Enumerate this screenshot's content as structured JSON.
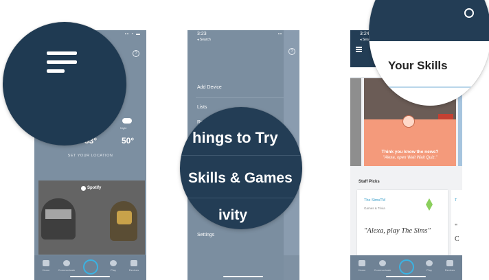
{
  "phone1": {
    "temps": [
      "53°",
      "50°"
    ],
    "night_label": "Night",
    "location_cta": "SET YOUR LOCATION",
    "spotify_label": "Spotify",
    "tabs": [
      "Home",
      "Communicate",
      "Play",
      "Devices"
    ]
  },
  "phone2": {
    "status_time": "3:23",
    "status_back": "◂ Search",
    "menu": [
      "Add Device",
      "Lists",
      "Reminders",
      "Settings"
    ],
    "zoom_lines": [
      "hings to Try",
      "Skills & Games",
      "ivity"
    ]
  },
  "phone3": {
    "status_time": "3:24",
    "status_back": "◂ Search",
    "zoom_title": "Your Skills",
    "news_title": "Think you know the news?",
    "news_sub": "\"Alexa, open Wait Wait Quiz.\"",
    "staff_picks_label": "Staff Picks",
    "skill_name": "The SimsTM",
    "skill_category": "Games & Trivia",
    "skill_quote": "\"Alexa, play The Sims\"",
    "peek_letter": "T",
    "peek_quote": "\"",
    "peek_char": "C",
    "tabs": [
      "Home",
      "Communicate",
      "Play",
      "Devices"
    ]
  },
  "colors": {
    "navy": "#1f3a52",
    "panel": "#7c8fa1",
    "alexa_ring": "#3ab3e3",
    "news_coral": "#f49a7b"
  },
  "icons": [
    "hamburger-icon",
    "help-icon",
    "cloud-icon",
    "spotify-icon",
    "alexa-icon",
    "home-icon",
    "chat-icon",
    "play-icon",
    "device-icon",
    "sims-plumbob-icon"
  ]
}
